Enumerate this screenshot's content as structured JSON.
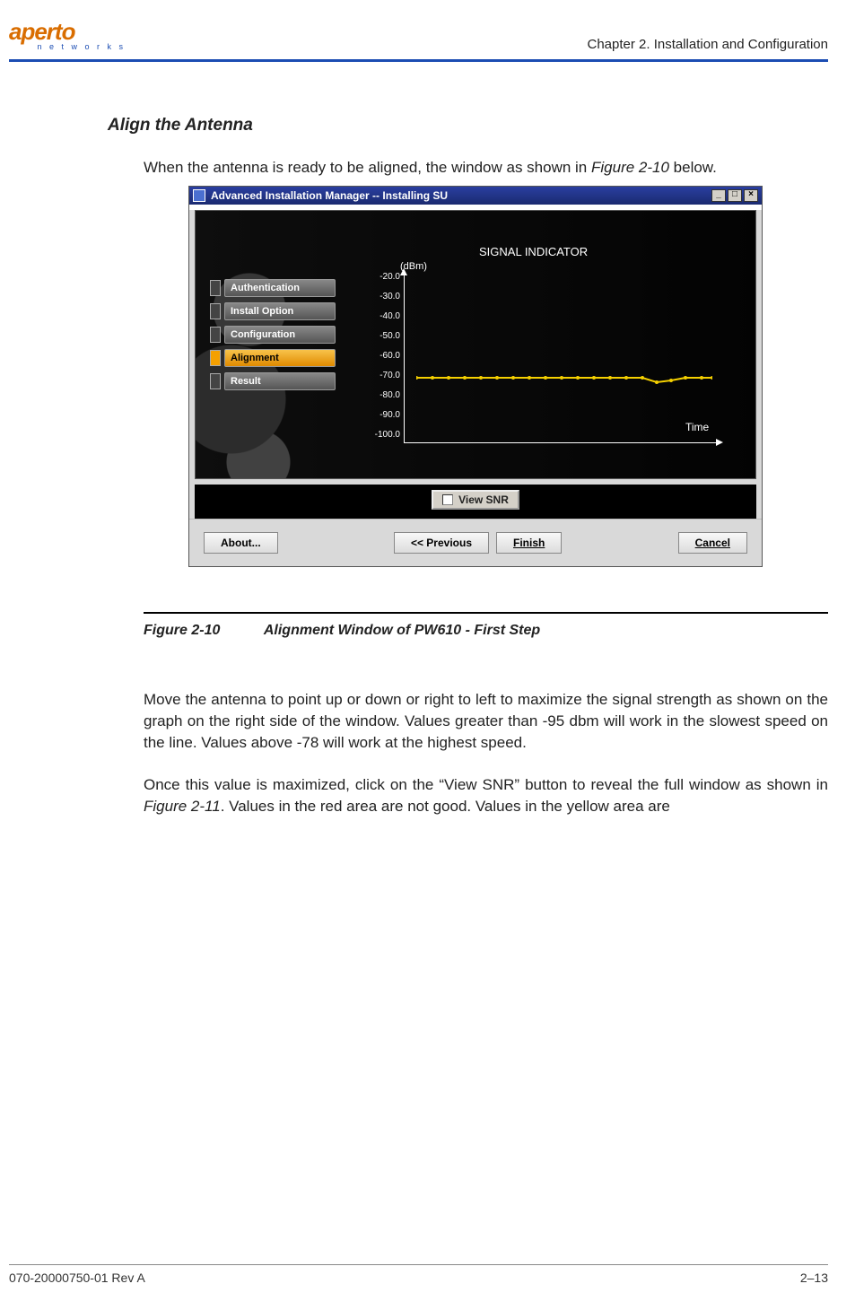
{
  "header": {
    "logo_text": "aperto",
    "logo_sub": "n e t w o r k s",
    "chapter": "Chapter 2.  Installation and Configuration"
  },
  "section_heading": "Align the Antenna",
  "intro": {
    "pre": "When the antenna is ready to be aligned, the window as shown in ",
    "ref": "Figure 2-10",
    "post": " below."
  },
  "screenshot": {
    "title": "Advanced Installation Manager -- Installing SU",
    "steps": [
      {
        "label": "Authentication",
        "active": false
      },
      {
        "label": "Install Option",
        "active": false
      },
      {
        "label": "Configuration",
        "active": false
      },
      {
        "label": "Alignment",
        "active": true
      },
      {
        "label": "Result",
        "active": false
      }
    ],
    "chart": {
      "title": "SIGNAL INDICATOR",
      "unit": "(dBm)",
      "xlabel": "Time"
    },
    "view_snr": "View SNR",
    "buttons": {
      "about": "About...",
      "previous": "<< Previous",
      "finish": "Finish",
      "cancel": "Cancel"
    }
  },
  "chart_data": {
    "type": "line",
    "title": "SIGNAL INDICATOR",
    "ylabel": "(dBm)",
    "xlabel": "Time",
    "ylim": [
      -100,
      -20
    ],
    "y_ticks": [
      "-20.0",
      "-30.0",
      "-40.0",
      "-50.0",
      "-60.0",
      "-70.0",
      "-80.0",
      "-90.0",
      "-100.0"
    ],
    "series": [
      {
        "name": "signal",
        "color": "#f5d000",
        "values": [
          -68,
          -68,
          -68,
          -68,
          -68,
          -68,
          -68,
          -68,
          -68,
          -68,
          -68,
          -68,
          -68,
          -68,
          -70,
          -69,
          -68,
          -68
        ]
      }
    ]
  },
  "figure": {
    "number": "Figure 2-10",
    "title": "Alignment Window of PW610 - First Step"
  },
  "para1": "Move the antenna to point up or down or right to left to maximize the signal strength as shown on the graph on the right side of the window. Values greater than -95 dbm will work in the slowest speed on the line. Values above -78 will work at the highest speed.",
  "para2": {
    "pre": "Once this value is maximized, click on the “View SNR” button to reveal the full window as shown in ",
    "ref": "Figure 2-11",
    "post": ". Values in the red area are not good. Values in the yellow area are"
  },
  "footer": {
    "left": "070-20000750-01 Rev A",
    "right": "2–13"
  }
}
